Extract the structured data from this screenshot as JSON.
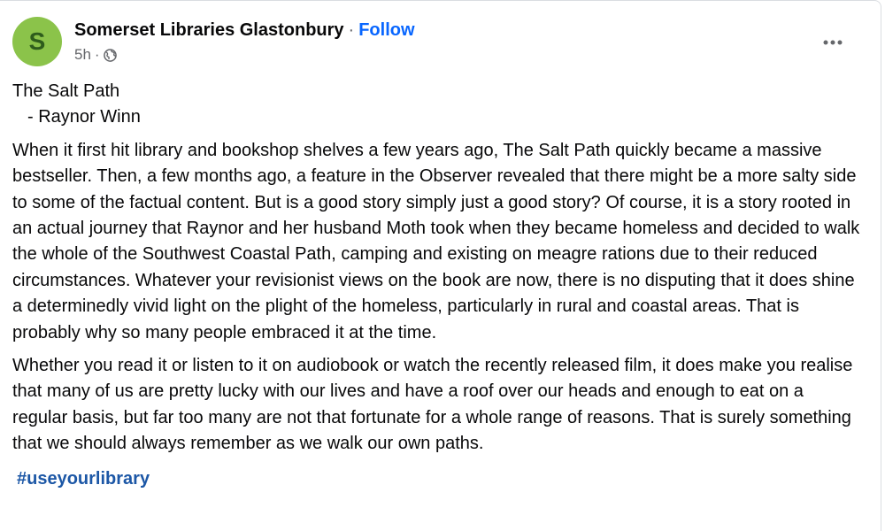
{
  "post": {
    "avatar_letter": "S",
    "page_name": "Somerset Libraries Glastonbury",
    "separator": "·",
    "follow_label": "Follow",
    "timestamp": "5h",
    "time_separator": "·",
    "audience_icon": "globe-icon",
    "more_icon": "more-options-icon",
    "title": "The Salt Path",
    "author": "- Raynor Winn",
    "paragraphs": [
      "When it first hit library and bookshop shelves a few years ago,  The Salt Path quickly became a massive bestseller. Then, a few months ago, a feature in the Observer revealed that there might be a more salty side to some of the factual content. But is a good story simply just  a good story? Of course, it is a story rooted in an actual journey that Raynor and her husband Moth took when they became homeless and decided to walk the whole of the Southwest Coastal Path, camping and existing on meagre rations due to their reduced circumstances. Whatever your revisionist views on the book are now, there is no disputing that it does shine a determinedly vivid light on the plight of the homeless, particularly in rural and coastal areas.  That is probably why so many people embraced it at the time.",
      "Whether you read it or listen to it on audiobook or watch the recently released film, it does make you realise that many of us are pretty lucky with our lives and have a roof over our heads and enough to eat on a regular basis, but far too many are not that fortunate for a whole range of reasons. That is surely something that we should always remember as we walk our own paths."
    ],
    "hashtag": "#useyourlibrary"
  },
  "colors": {
    "avatar_bg": "#8bc34a",
    "avatar_fg": "#2e5c1c",
    "follow_link": "#0866ff",
    "hashtag": "#1c57a6",
    "secondary_text": "#65676b",
    "primary_text": "#080809"
  }
}
